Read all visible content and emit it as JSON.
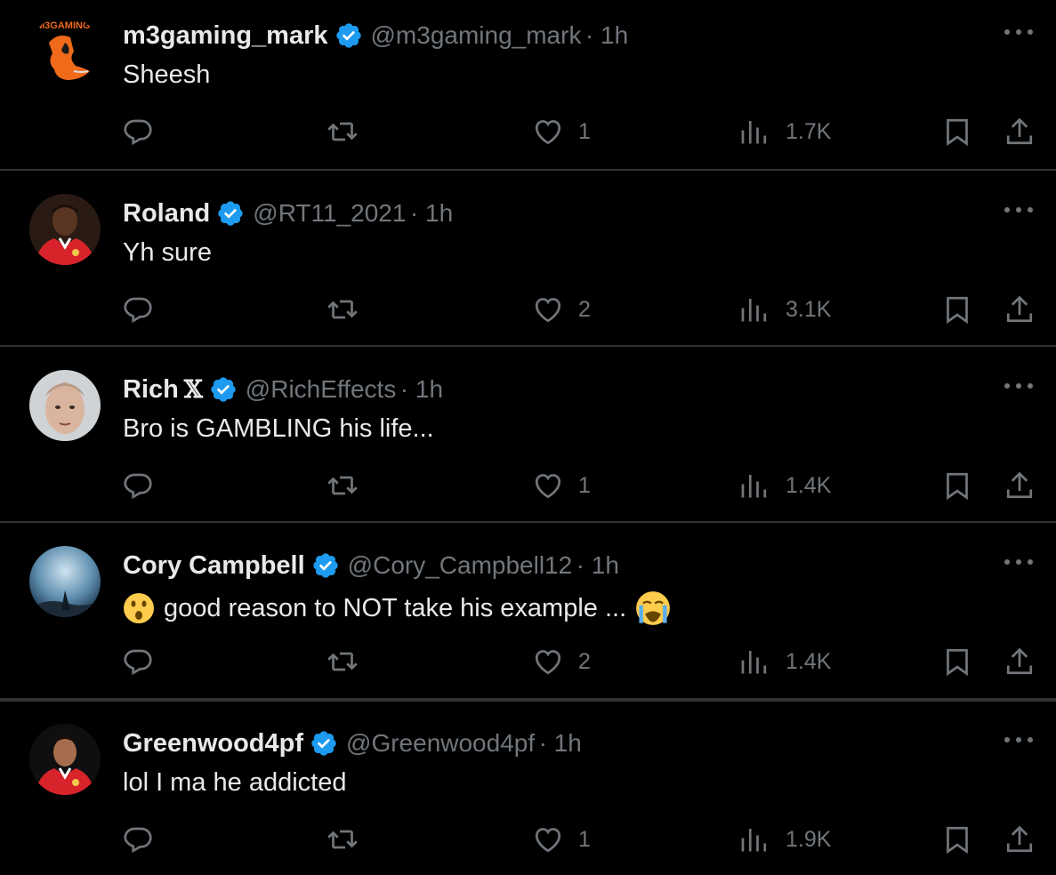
{
  "colors": {
    "background": "#000000",
    "text": "#e7e9ea",
    "muted": "#71767b",
    "divider": "#2f3336",
    "verified": "#1d9bf0"
  },
  "icons": {
    "verified": "verified-badge-icon",
    "reply": "reply-icon",
    "retweet": "retweet-icon",
    "like": "heart-icon",
    "views": "views-chart-icon",
    "bookmark": "bookmark-icon",
    "share": "share-icon",
    "more": "more-dots-icon"
  },
  "tweets": [
    {
      "name": "m3gaming_mark",
      "x_suffix": "",
      "handle": "@m3gaming_mark",
      "time": "· 1h",
      "text_before": "",
      "text": "Sheesh",
      "text_after": "",
      "likes": "1",
      "views": "1.7K",
      "avatar_text": "M3GAMING"
    },
    {
      "name": "Roland",
      "x_suffix": "",
      "handle": "@RT11_2021",
      "time": "· 1h",
      "text_before": "",
      "text": "Yh sure",
      "text_after": "",
      "likes": "2",
      "views": "3.1K"
    },
    {
      "name": "Rich",
      "x_suffix": "𝕏",
      "handle": "@RichEffects",
      "time": "· 1h",
      "text_before": "",
      "text": "Bro is GAMBLING his life...",
      "text_after": "",
      "likes": "1",
      "views": "1.4K"
    },
    {
      "name": "Cory Campbell",
      "x_suffix": "",
      "handle": "@Cory_Campbell12",
      "time": "· 1h",
      "text_before": "😮",
      "text": "good reason to NOT take his example ...",
      "text_after": "😭",
      "likes": "2",
      "views": "1.4K"
    },
    {
      "name": "Greenwood4pf",
      "x_suffix": "",
      "handle": "@Greenwood4pf",
      "time": "· 1h",
      "text_before": "",
      "text": "lol I ma he addicted",
      "text_after": "",
      "likes": "1",
      "views": "1.9K"
    }
  ]
}
